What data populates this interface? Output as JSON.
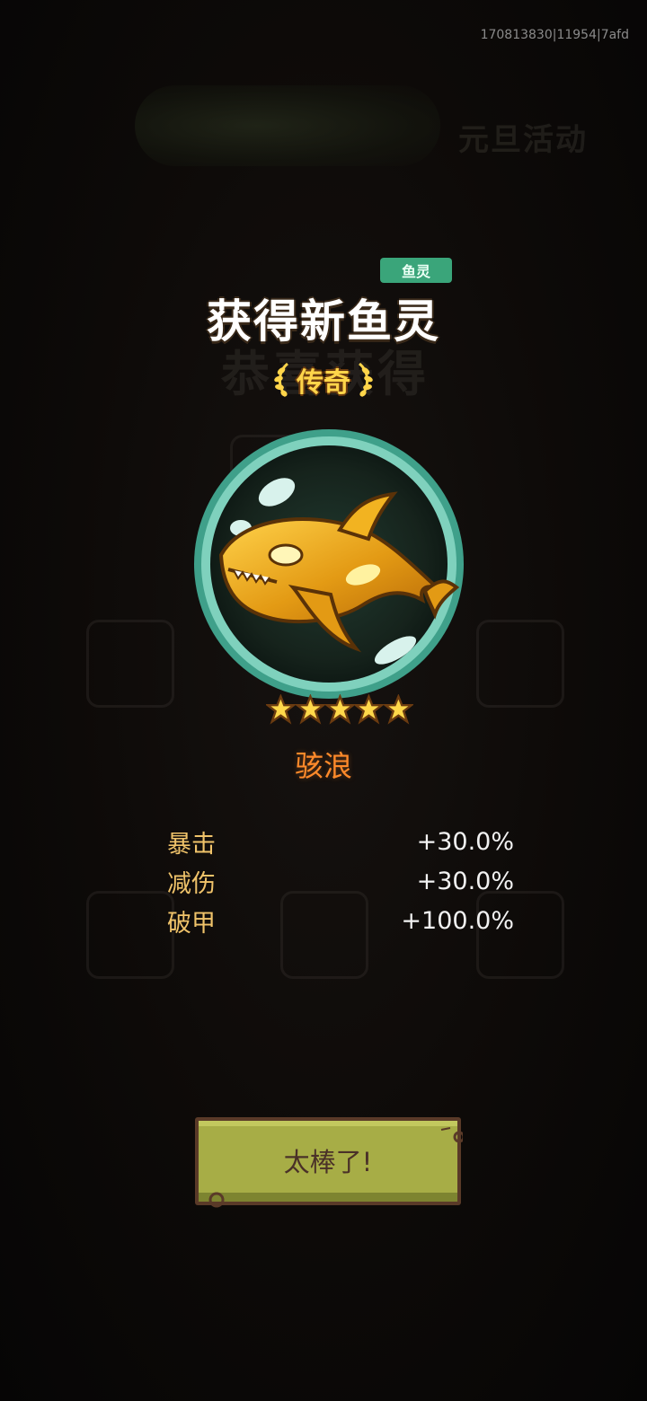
{
  "session_id": "170813830|11954|7afd",
  "background": {
    "event_title": "元旦活动",
    "ghost_heading": "恭喜获得"
  },
  "reward": {
    "tag": "鱼灵",
    "headline": "获得新鱼灵",
    "rarity": "传奇",
    "fish_name": "骇浪",
    "stars": 5,
    "stats": [
      {
        "name": "暴击",
        "value": "+30.0%"
      },
      {
        "name": "减伤",
        "value": "+30.0%"
      },
      {
        "name": "破甲",
        "value": "+100.0%"
      }
    ]
  },
  "confirm_button": {
    "label": "太棒了!"
  },
  "colors": {
    "tag_bg": "#3aa57a",
    "rarity_gold": "#ffd54a",
    "fish_name": "#ff8a2a",
    "stat_name": "#f0c36a",
    "button_fill": "#a7ad46"
  }
}
